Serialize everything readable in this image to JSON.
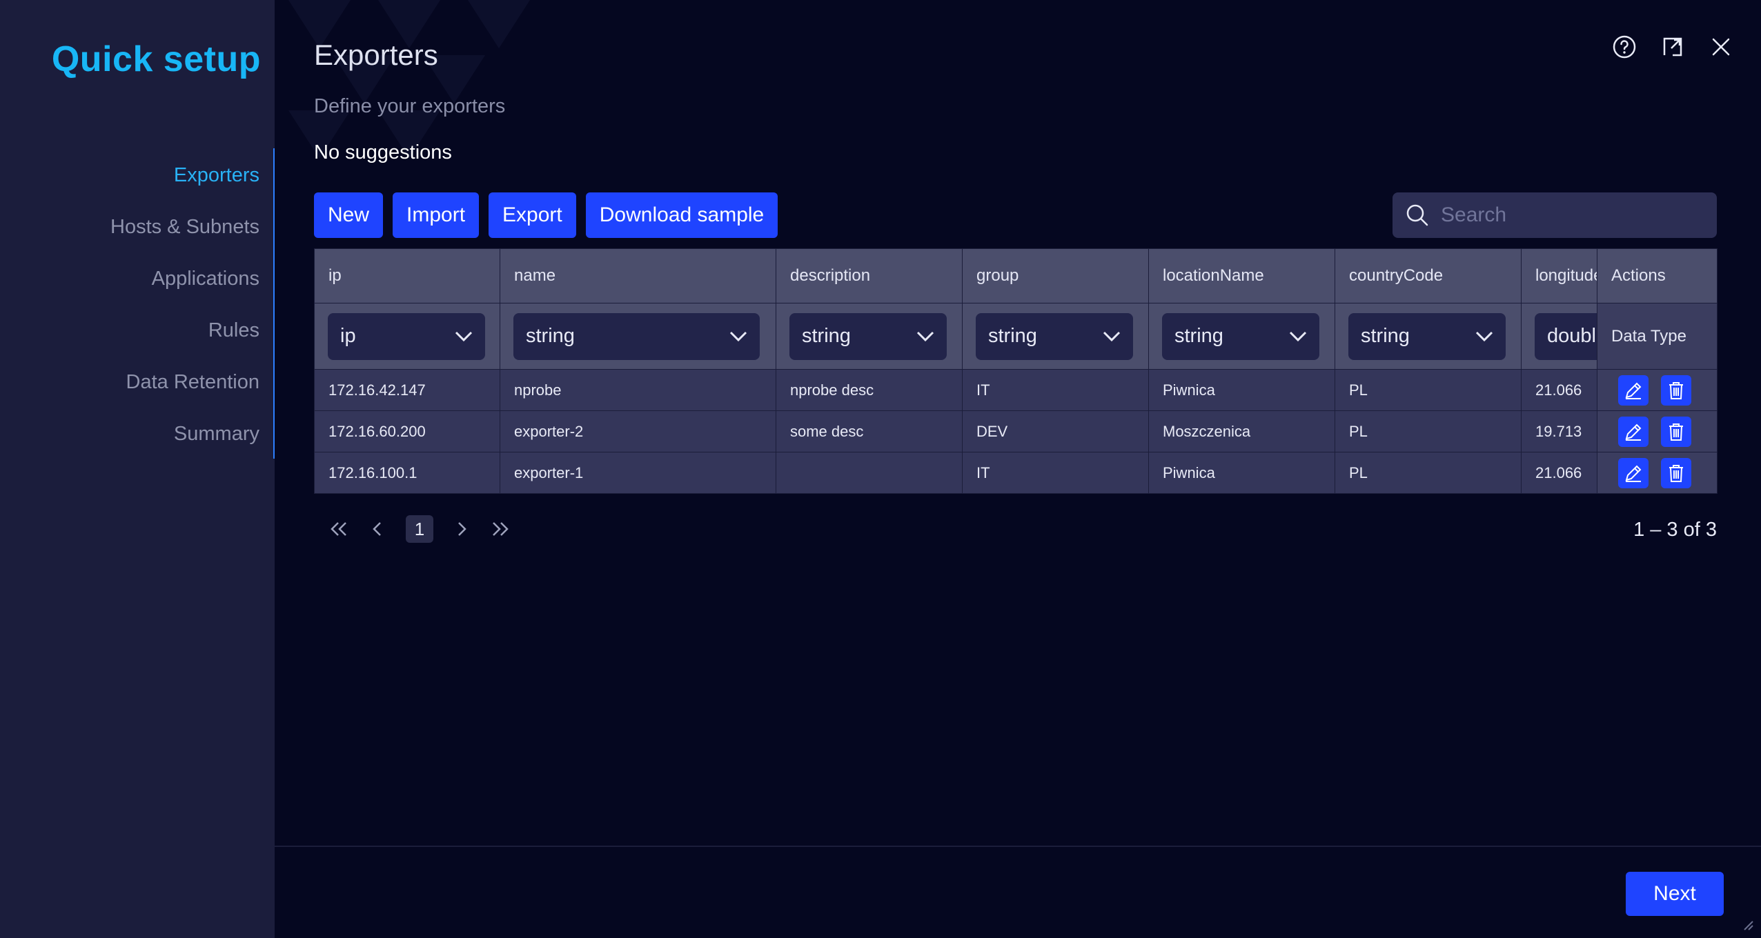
{
  "sidebar": {
    "brand": "Quick setup",
    "items": [
      {
        "label": "Exporters",
        "active": true
      },
      {
        "label": "Hosts & Subnets",
        "active": false
      },
      {
        "label": "Applications",
        "active": false
      },
      {
        "label": "Rules",
        "active": false
      },
      {
        "label": "Data Retention",
        "active": false
      },
      {
        "label": "Summary",
        "active": false
      }
    ]
  },
  "header": {
    "title": "Exporters",
    "subtitle": "Define your exporters",
    "suggestions": "No suggestions"
  },
  "toolbar": {
    "new_label": "New",
    "import_label": "Import",
    "export_label": "Export",
    "download_label": "Download sample"
  },
  "search": {
    "placeholder": "Search",
    "value": ""
  },
  "table": {
    "columns": [
      "ip",
      "name",
      "description",
      "group",
      "locationName",
      "countryCode",
      "longitude",
      "Actions"
    ],
    "types": [
      "ip",
      "string",
      "string",
      "string",
      "string",
      "string",
      "double"
    ],
    "actions_type_label": "Data Type",
    "rows": [
      [
        "172.16.42.147",
        "nprobe",
        "nprobe desc",
        "IT",
        "Piwnica",
        "PL",
        "21.066"
      ],
      [
        "172.16.60.200",
        "exporter-2",
        "some desc",
        "DEV",
        "Moszczenica",
        "PL",
        "19.713"
      ],
      [
        "172.16.100.1",
        "exporter-1",
        "",
        "IT",
        "Piwnica",
        "PL",
        "21.066"
      ]
    ]
  },
  "pagination": {
    "current_page": "1",
    "range_text": "1 – 3 of 3"
  },
  "footer": {
    "next_label": "Next"
  },
  "colors": {
    "accent": "#1f44ff",
    "brand": "#18b6f6",
    "background": "#050720",
    "sidebar": "#1b1d3c"
  }
}
